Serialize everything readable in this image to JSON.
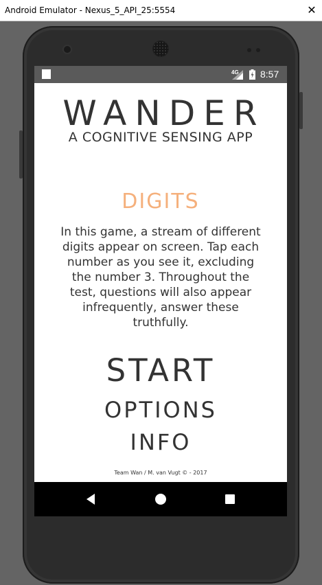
{
  "window": {
    "title": "Android Emulator - Nexus_5_API_25:5554",
    "close_glyph": "✕"
  },
  "status_bar": {
    "network": "4G",
    "time": "8:57"
  },
  "app": {
    "title": "WANDER",
    "subtitle": "A COGNITIVE SENSING APP"
  },
  "game": {
    "title": "DIGITS",
    "description": "In this game, a stream of different digits appear on screen. Tap each number as you see it, excluding the number 3. Throughout the test, questions will also appear infrequently, answer these truthfully."
  },
  "menu": {
    "start_label": "START",
    "options_label": "OPTIONS",
    "info_label": "INFO"
  },
  "footer": {
    "credit": "Team Wan / M. van Vugt © - 2017"
  },
  "colors": {
    "accent": "#f5b07c",
    "text": "#333333",
    "status_bar": "#5a5a5a",
    "nav_bar": "#000000"
  },
  "icons": {
    "status": [
      "notification-icon",
      "signal-icon",
      "battery-icon"
    ],
    "nav": [
      "back-icon",
      "home-icon",
      "recents-icon"
    ]
  }
}
